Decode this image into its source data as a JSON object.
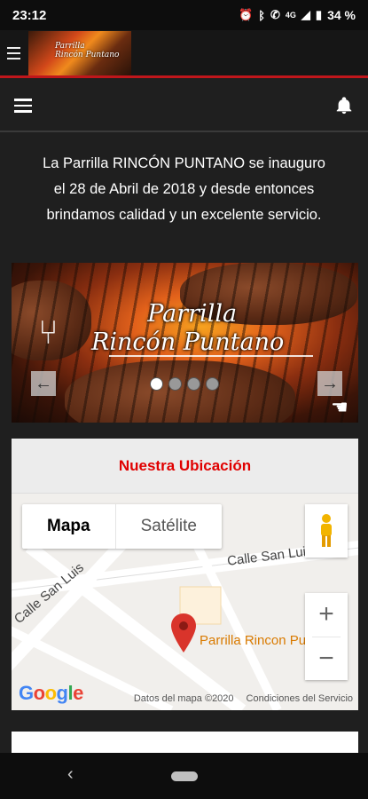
{
  "status_bar": {
    "time": "23:12",
    "icons": [
      "alarm-icon",
      "bluetooth-icon",
      "call-icon",
      "signal-icon",
      "battery-icon"
    ],
    "network": "4G",
    "battery": "34 %"
  },
  "header": {
    "logo_text_line1": "Parrilla",
    "logo_text_line2": "Rincón Puntano",
    "accent_color": "#c0161b"
  },
  "nav": {
    "menu_icon": "hamburger-icon",
    "bell_icon": "bell-icon"
  },
  "intro": {
    "line1": "La Parrilla RINCÓN PUNTANO se inauguro",
    "line2": "el 28 de Abril de 2018 y desde entonces",
    "line3": "brindamos calidad y un excelente servicio."
  },
  "slider": {
    "title_line1": "Parrilla",
    "title_line2": "Rincón Puntano",
    "prev_glyph": "←",
    "next_glyph": "→",
    "slide_count": 4,
    "active_slide": 1
  },
  "location": {
    "heading": "Nuestra Ubicación",
    "heading_color": "#e00000",
    "map_type_options": [
      "Mapa",
      "Satélite"
    ],
    "selected_map_type": "Mapa",
    "streets": [
      "Calle San Luis",
      "Calle San Luis"
    ],
    "poi_label": "Parrilla Rincon Puntano",
    "zoom_in": "+",
    "zoom_out": "−",
    "google": "Google",
    "map_data": "Datos del mapa ©2020",
    "terms": "Condiciones del Servicio"
  },
  "system_nav": {
    "back": "‹"
  }
}
